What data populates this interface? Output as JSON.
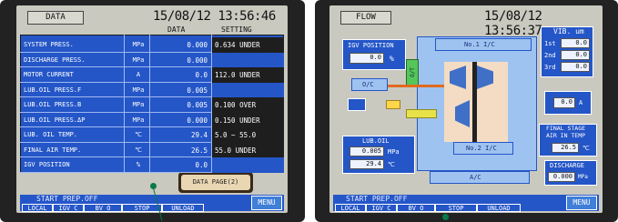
{
  "left_screen": {
    "header": "DATA",
    "datetime": "15/08/12 13:56:46",
    "col_data": "DATA",
    "col_setting": "SETTING",
    "rows": [
      {
        "name": "SYSTEM PRESS.",
        "unit": "MPa",
        "value": "0.000",
        "setting": "0.634 UNDER"
      },
      {
        "name": "DISCHARGE PRESS.",
        "unit": "MPa",
        "value": "0.000",
        "setting": ""
      },
      {
        "name": "MOTOR CURRENT",
        "unit": "A",
        "value": "0.0",
        "setting": "112.0 UNDER"
      },
      {
        "name": "LUB.OIL PRESS.F",
        "unit": "MPa",
        "value": "0.005",
        "setting": ""
      },
      {
        "name": "LUB.OIL PRESS.B",
        "unit": "MPa",
        "value": "0.005",
        "setting": "0.100 OVER"
      },
      {
        "name": "LUB.OIL PRESS.ΔP",
        "unit": "MPa",
        "value": "0.000",
        "setting": "0.150 UNDER"
      },
      {
        "name": "LUB. OIL TEMP.",
        "unit": "℃",
        "value": "29.4",
        "setting": "5.0 ~ 55.0"
      },
      {
        "name": "FINAL AIR TEMP.",
        "unit": "℃",
        "value": "26.5",
        "setting": "55.0 UNDER"
      },
      {
        "name": "IGV POSITION",
        "unit": "%",
        "value": "0.0",
        "setting": ""
      }
    ],
    "data_page_button": "DATA PAGE(2)",
    "status_text": "START PREP.OFF",
    "function_keys": [
      "LOCAL",
      "IGV_C",
      "BV_O",
      "STOP",
      "UNLOAD"
    ],
    "menu_button": "MENU"
  },
  "right_screen": {
    "header": "FLOW",
    "datetime": "15/08/12 13:56:37",
    "igv_position_label": "IGV POSITION",
    "igv_position_value": "0.0",
    "igv_position_unit": "%",
    "vib_label": "VIB. um",
    "vib_rows": [
      {
        "label": "1st",
        "value": "0.0"
      },
      {
        "label": "2nd",
        "value": "0.0"
      },
      {
        "label": "3rd",
        "value": "0.0"
      }
    ],
    "stage1_label": "No.1 I/C",
    "stage2_label": "No.2 I/C",
    "oc_label": "O/C",
    "ac_label": "A/C",
    "ot_label": "O/T",
    "right_value": "0.0",
    "right_unit": "A",
    "lub_oil_label": "LUB.OIL",
    "lub_oil_press": "0.005",
    "lub_oil_press_unit": "MPa",
    "lub_oil_temp": "29.4",
    "lub_oil_temp_unit": "℃",
    "final_stage_label_1": "FINAL STAGE",
    "final_stage_label_2": "AIR IN TEMP",
    "final_stage_value": "26.5",
    "final_stage_unit": "℃",
    "discharge_label": "DISCHARGE",
    "discharge_value": "0.000",
    "discharge_unit": "MPa",
    "status_text": "START PREP.OFF",
    "function_keys": [
      "LOCAL",
      "IGV_C",
      "BV_O",
      "STOP",
      "UNLOAD"
    ],
    "menu_button": "MENU"
  }
}
